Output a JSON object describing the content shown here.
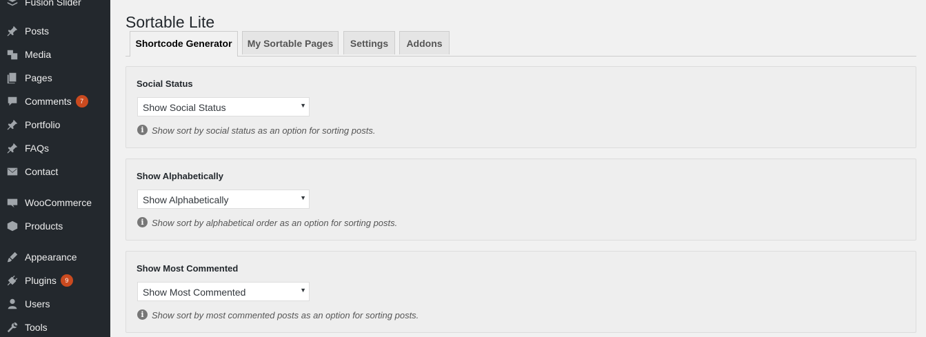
{
  "sidebar": {
    "items": [
      {
        "label": "Fusion Slider",
        "icon": "layers-icon"
      },
      {
        "label": "Posts",
        "icon": "pin-icon"
      },
      {
        "label": "Media",
        "icon": "media-icon"
      },
      {
        "label": "Pages",
        "icon": "pages-icon"
      },
      {
        "label": "Comments",
        "icon": "comment-icon",
        "count": "7"
      },
      {
        "label": "Portfolio",
        "icon": "pin-icon"
      },
      {
        "label": "FAQs",
        "icon": "pin-icon"
      },
      {
        "label": "Contact",
        "icon": "mail-icon"
      },
      {
        "label": "WooCommerce",
        "icon": "woo-icon"
      },
      {
        "label": "Products",
        "icon": "box-icon"
      },
      {
        "label": "Appearance",
        "icon": "brush-icon"
      },
      {
        "label": "Plugins",
        "icon": "plug-icon",
        "count": "9"
      },
      {
        "label": "Users",
        "icon": "user-icon"
      },
      {
        "label": "Tools",
        "icon": "wrench-icon"
      }
    ]
  },
  "page": {
    "title": "Sortable Lite"
  },
  "tabs": [
    {
      "label": "Shortcode Generator",
      "active": true
    },
    {
      "label": "My Sortable Pages"
    },
    {
      "label": "Settings"
    },
    {
      "label": "Addons"
    }
  ],
  "panels": [
    {
      "label": "Social Status",
      "select_value": "Show Social Status",
      "description": "Show sort by social status as an option for sorting posts."
    },
    {
      "label": "Show Alphabetically",
      "select_value": "Show Alphabetically",
      "description": "Show sort by alphabetical order as an option for sorting posts."
    },
    {
      "label": "Show Most Commented",
      "select_value": "Show Most Commented",
      "description": "Show sort by most commented posts as an option for sorting posts."
    }
  ],
  "colors": {
    "sidebar_bg": "#23282d",
    "badge": "#ca4a1f",
    "page_bg": "#f1f1f1"
  }
}
